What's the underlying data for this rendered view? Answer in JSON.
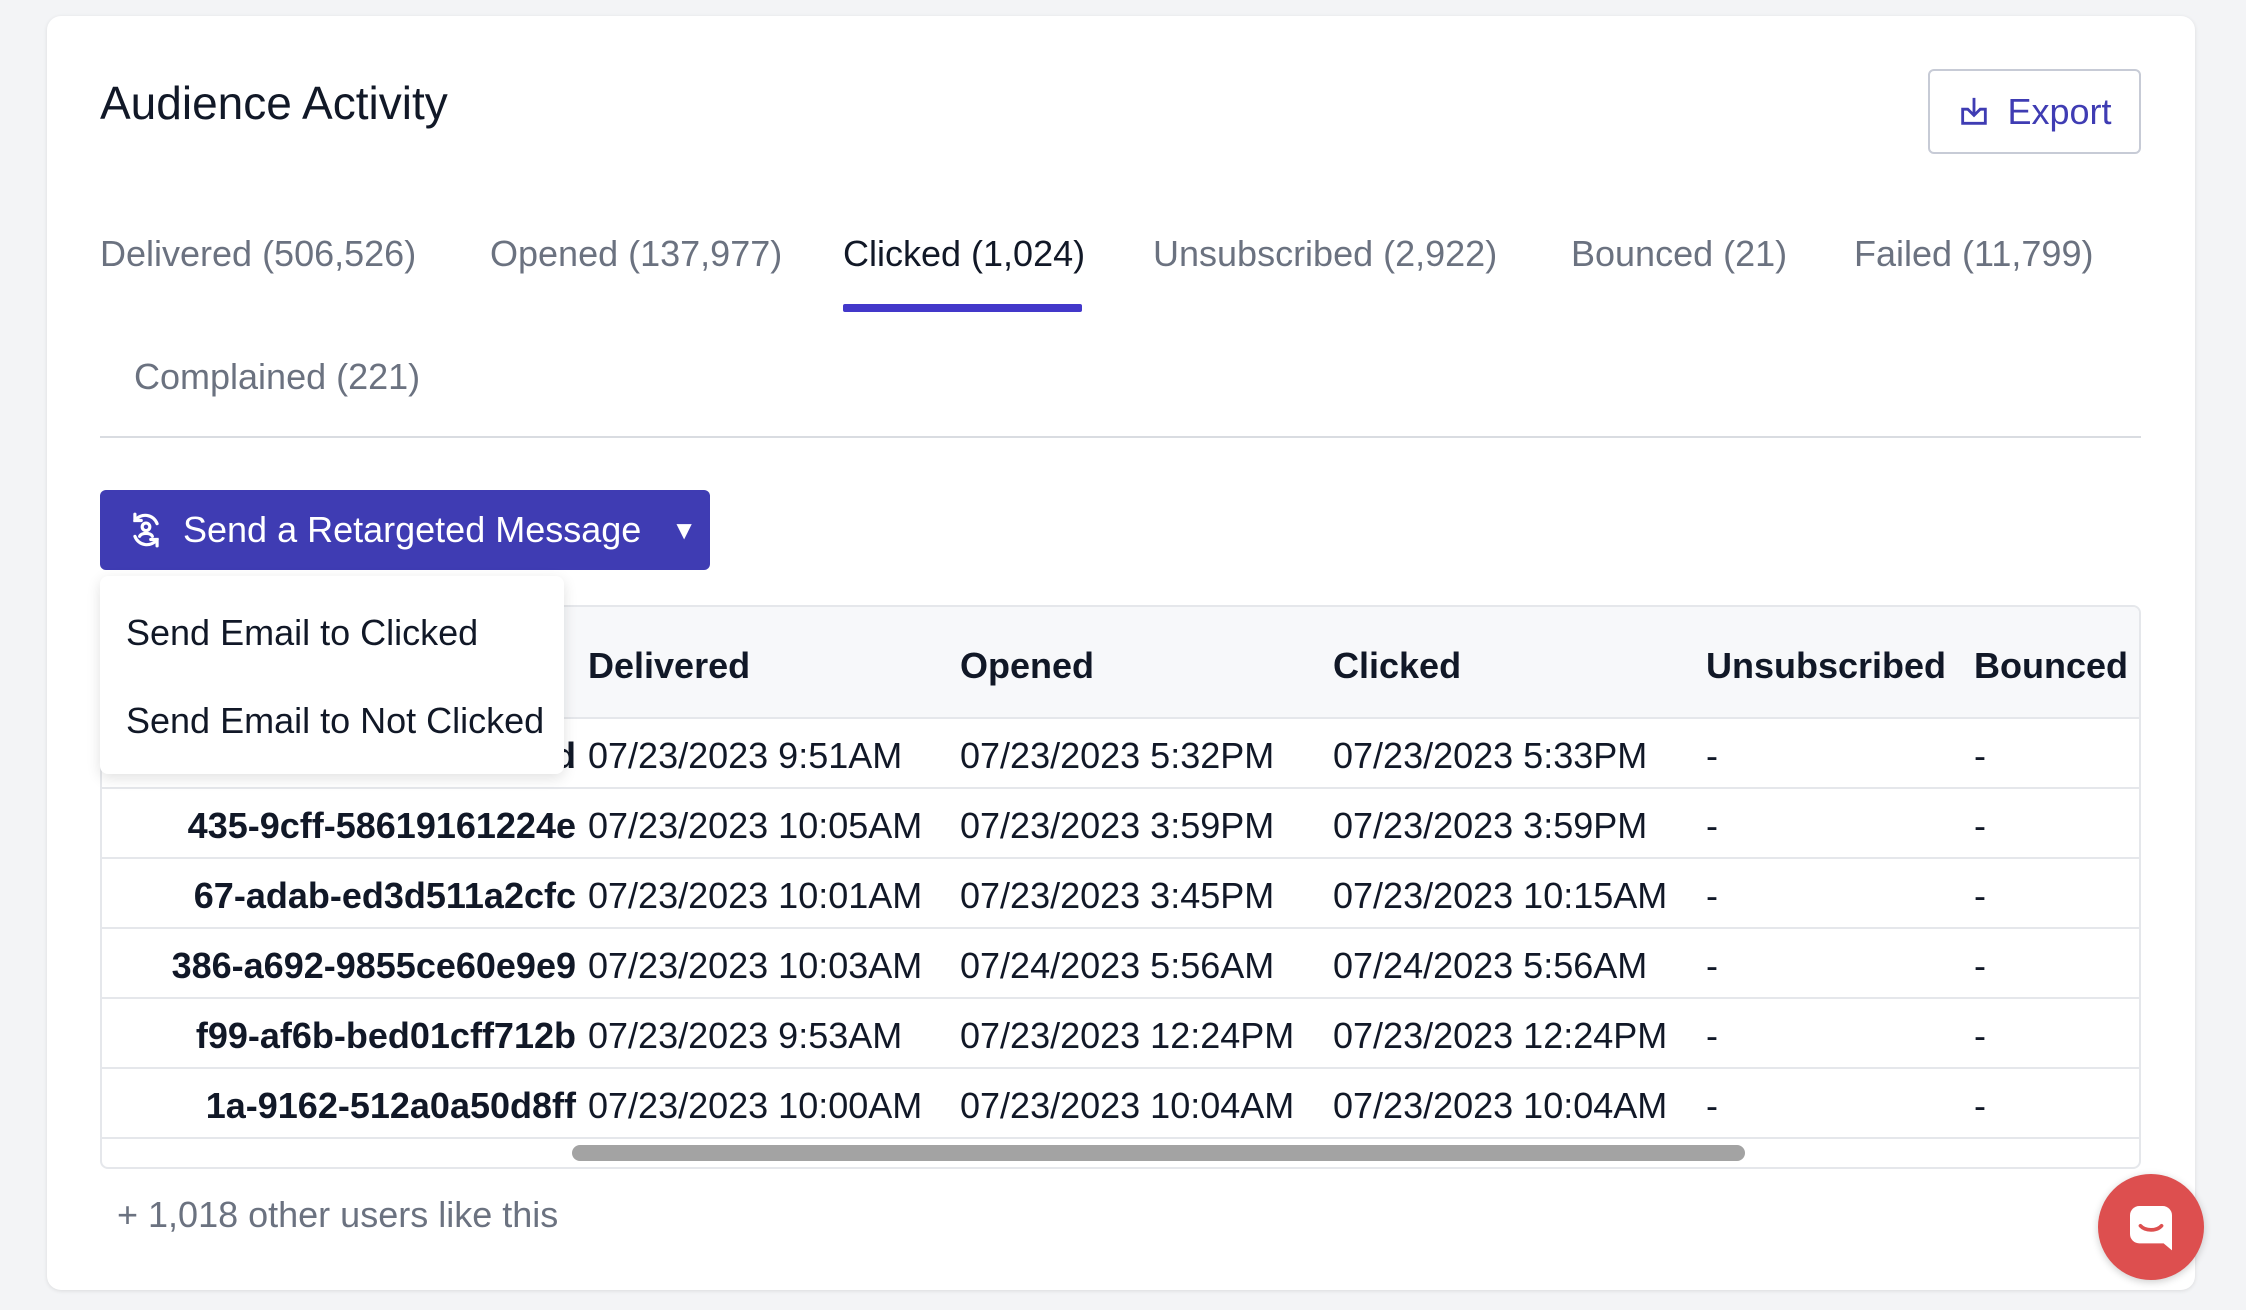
{
  "header": {
    "title": "Audience Activity",
    "export_label": "Export"
  },
  "tabs": [
    {
      "label": "Delivered (506,526)",
      "active": false
    },
    {
      "label": "Opened (137,977)",
      "active": false
    },
    {
      "label": "Clicked (1,024)",
      "active": true
    },
    {
      "label": "Unsubscribed (2,922)",
      "active": false
    },
    {
      "label": "Bounced (21)",
      "active": false
    },
    {
      "label": "Failed (11,799)",
      "active": false
    },
    {
      "label": "Complained (221)",
      "active": false
    }
  ],
  "retarget": {
    "label": "Send a Retargeted Message",
    "menu": [
      "Send Email to Clicked",
      "Send Email to Not Clicked"
    ]
  },
  "table": {
    "columns": [
      "Delivered",
      "Opened",
      "Clicked",
      "Unsubscribed",
      "Bounced"
    ],
    "rows": [
      {
        "id": "3ae-84e9-9be8ac6f132d",
        "delivered": "07/23/2023 9:51AM",
        "opened": "07/23/2023 5:32PM",
        "clicked": "07/23/2023 5:33PM",
        "unsubscribed": "-",
        "bounced": "-"
      },
      {
        "id": "435-9cff-58619161224e",
        "delivered": "07/23/2023 10:05AM",
        "opened": "07/23/2023 3:59PM",
        "clicked": "07/23/2023 3:59PM",
        "unsubscribed": "-",
        "bounced": "-"
      },
      {
        "id": "67-adab-ed3d511a2cfc",
        "delivered": "07/23/2023 10:01AM",
        "opened": "07/23/2023 3:45PM",
        "clicked": "07/23/2023 10:15AM",
        "unsubscribed": "-",
        "bounced": "-"
      },
      {
        "id": "386-a692-9855ce60e9e9",
        "delivered": "07/23/2023 10:03AM",
        "opened": "07/24/2023 5:56AM",
        "clicked": "07/24/2023 5:56AM",
        "unsubscribed": "-",
        "bounced": "-"
      },
      {
        "id": "f99-af6b-bed01cff712b",
        "delivered": "07/23/2023 9:53AM",
        "opened": "07/23/2023 12:24PM",
        "clicked": "07/23/2023 12:24PM",
        "unsubscribed": "-",
        "bounced": "-"
      },
      {
        "id": "1a-9162-512a0a50d8ff",
        "delivered": "07/23/2023 10:00AM",
        "opened": "07/23/2023 10:04AM",
        "clicked": "07/23/2023 10:04AM",
        "unsubscribed": "-",
        "bounced": "-"
      }
    ]
  },
  "footer": {
    "more_users": "+ 1,018 other users like this"
  },
  "colors": {
    "accent": "#3f3cb3",
    "chat_launcher": "#dd4f4f"
  },
  "icons": {
    "export": "download-icon",
    "retarget": "retarget-icon",
    "caret": "caret-down-icon",
    "chat": "chat-icon"
  }
}
